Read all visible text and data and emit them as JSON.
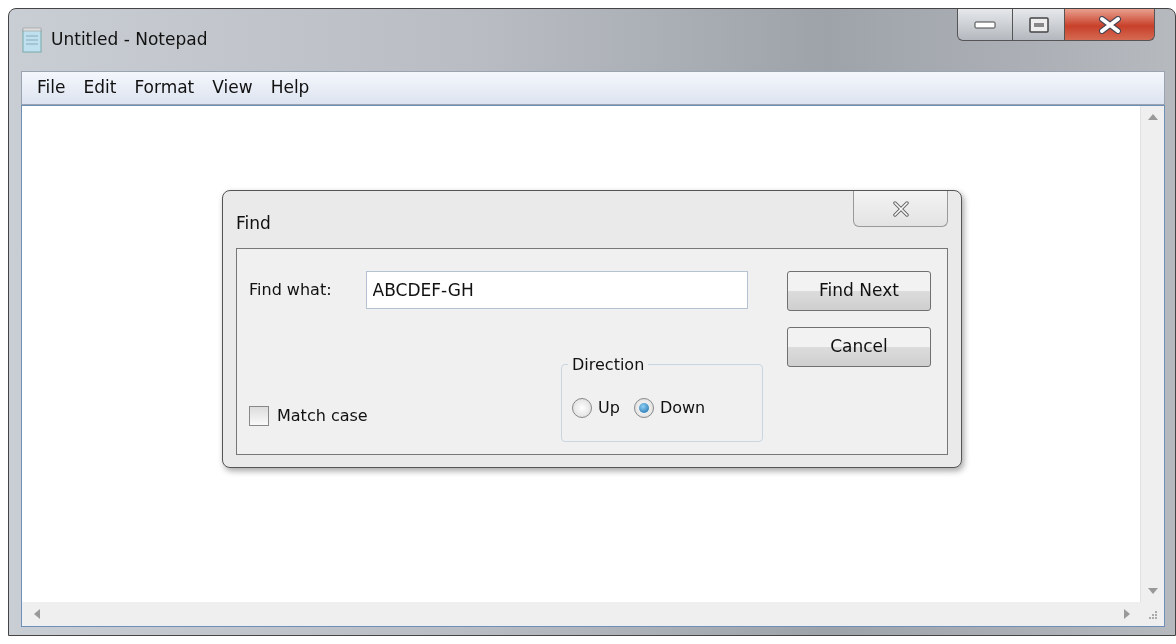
{
  "window": {
    "title": "Untitled - Notepad"
  },
  "menu": [
    "File",
    "Edit",
    "Format",
    "View",
    "Help"
  ],
  "find_dialog": {
    "title": "Find",
    "find_what": {
      "label": "Find what:",
      "value": "ABCDEF-GH"
    },
    "match_case": {
      "label": "Match case",
      "checked": false
    },
    "direction": {
      "label": "Direction",
      "options": [
        {
          "label": "Up",
          "selected": false
        },
        {
          "label": "Down",
          "selected": true
        }
      ]
    },
    "buttons": [
      "Find Next",
      "Cancel"
    ]
  }
}
